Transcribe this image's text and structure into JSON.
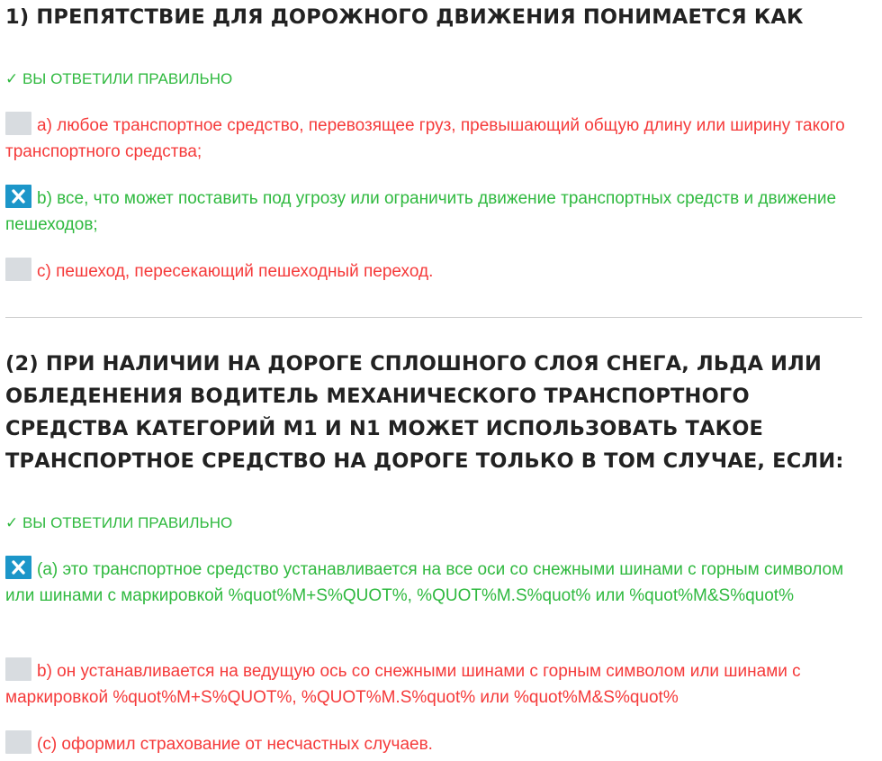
{
  "questions": [
    {
      "title": "1) ПРЕПЯТСТВИЕ ДЛЯ ДОРОЖНОГО ДВИЖЕНИЯ ПОНИМАЕТСЯ КАК",
      "result": "✓ ВЫ ОТВЕТИЛИ ПРАВИЛЬНО",
      "answers": [
        {
          "text": "a) любое транспортное средство, перевозящее груз, превышающий общую длину или ширину такого транспортного средства;",
          "checked": false,
          "correct": false
        },
        {
          "text": "b) все, что может поставить под угрозу или ограничить движение транспортных средств и движение пешеходов;",
          "checked": true,
          "correct": true
        },
        {
          "text": "c) пешеход, пересекающий пешеходный переход.",
          "checked": false,
          "correct": false
        }
      ]
    },
    {
      "title": "(2) ПРИ НАЛИЧИИ НА ДОРОГЕ СПЛОШНОГО СЛОЯ СНЕГА, ЛЬДА ИЛИ ОБЛЕДЕНЕНИЯ ВОДИТЕЛЬ МЕХАНИЧЕСКОГО ТРАНСПОРТНОГО СРЕДСТВА КАТЕГОРИЙ M1 И N1 МОЖЕТ ИСПОЛЬЗОВАТЬ ТАКОЕ ТРАНСПОРТНОЕ СРЕДСТВО НА ДОРОГЕ ТОЛЬКО В ТОМ СЛУЧАЕ, ЕСЛИ:",
      "result": "✓ ВЫ ОТВЕТИЛИ ПРАВИЛЬНО",
      "answers": [
        {
          "text": "(a) это транспортное средство устанавливается на все оси со снежными шинами с горным символом или шинами с маркировкой %quot%M+S%QUOT%, %QUOT%M.S%quot% или %quot%M&S%quot%",
          "checked": true,
          "correct": true
        },
        {
          "text": "b) он устанавливается на ведущую ось со снежными шинами с горным символом или шинами с маркировкой %quot%M+S%QUOT%, %QUOT%M.S%quot% или %quot%M&S%quot%",
          "checked": false,
          "correct": false
        },
        {
          "text": "(c) оформил страхование от несчастных случаев.",
          "checked": false,
          "correct": false
        }
      ]
    }
  ],
  "colors": {
    "correct": "#2fb93f",
    "wrong": "#f53a3a",
    "checkbox_checked": "#1c96c9",
    "checkbox_unchecked": "#d8dce0",
    "divider": "#cfcfcf"
  },
  "icons": {
    "checked": "close-icon",
    "result": "checkmark-icon"
  }
}
